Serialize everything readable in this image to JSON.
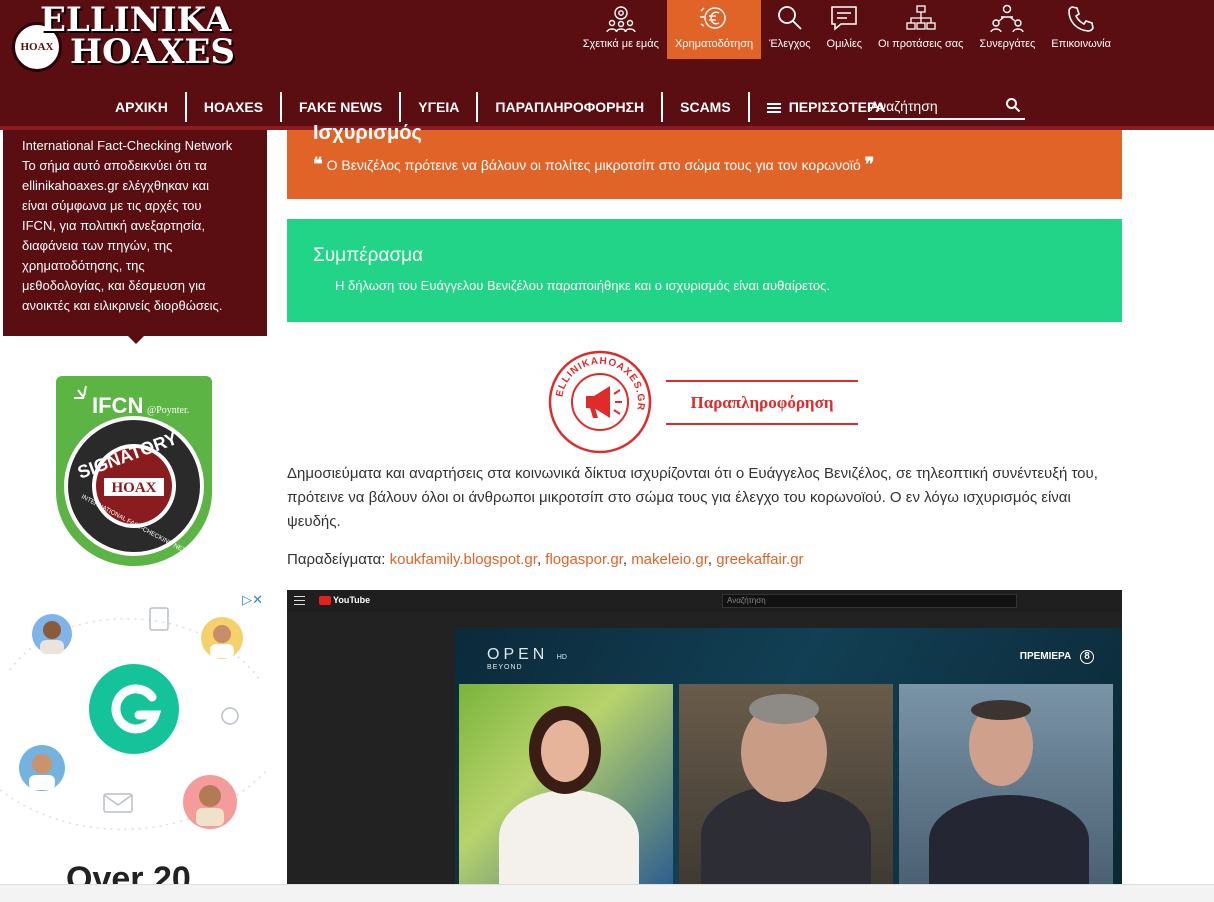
{
  "header": {
    "logo_line1": "ELLINIKA",
    "logo_line2": "HOAXES",
    "logo_seal": "HOAX",
    "top_nav": [
      {
        "label": "Σχετικά με εμάς",
        "icon": "team-gear-icon"
      },
      {
        "label": "Χρηματοδότηση",
        "icon": "funding-euro-icon",
        "active": true
      },
      {
        "label": "Έλεγχος",
        "icon": "magnifier-icon"
      },
      {
        "label": "Ομιλίες",
        "icon": "speech-bubble-icon"
      },
      {
        "label": "Οι προτάσεις σας",
        "icon": "network-icon"
      },
      {
        "label": "Συνεργάτες",
        "icon": "partners-icon"
      },
      {
        "label": "Επικοινωνία",
        "icon": "phone-icon"
      }
    ],
    "main_nav": [
      "ΑΡΧΙΚΗ",
      "HOAXES",
      "FAKE NEWS",
      "ΥΓΕΙΑ",
      "ΠΑΡΑΠΛΗΡΟΦΟΡΗΣΗ",
      "SCAMS",
      "ΠΕΡΙΣΣΟΤΕΡΑ"
    ],
    "search_placeholder": "Αναζήτηση"
  },
  "colors": {
    "header_bg": "#5a0e12",
    "accent_orange": "#e06428",
    "conclusion_green": "#22d487",
    "verdict_red": "#e02b2b"
  },
  "sidebar": {
    "ifcn_text_lines": [
      "International Fact-Checking Network",
      "Το σήμα αυτό αποδεικνύει ότι τα",
      "ellinikahoaxes.gr ελέγχθηκαν και",
      "είναι σύμφωνα με τις αρχές του",
      "IFCN, για πολιτική ανεξαρτησία,",
      "διαφάνεια των πηγών, της",
      "χρηματοδότησης, της",
      "μεθοδολογίας, και δέσμευση για",
      "ανοικτές και ειλικρινείς διορθώσεις."
    ],
    "badge": {
      "ifcn": "IFCN",
      "poynter": "@Poynter.",
      "signatory": "SIGNATORY",
      "hoax": "HOAX",
      "ring_text": "INTERNATIONAL FACT-CHECKING NETWORK"
    },
    "ad": {
      "headline": "Over 20"
    }
  },
  "article": {
    "claim_title": "Ισχυρισμός",
    "claim_text": "Ο Βενιζέλος πρότεινε να βάλουν οι πολίτες μικροτσίπ στο σώμα τους για τον κορωνοϊό",
    "conclusion_title": "Συμπέρασμα",
    "conclusion_text": "Η δήλωση του Ευάγγελου Βενιζέλου παραποιήθηκε και ο ισχυρισμός είναι αυθαίρετος.",
    "stamp_text": "ELLINIKAHOAXES.GR",
    "verdict": "Παραπληροφόρηση",
    "body": "Δημοσιεύματα και αναρτήσεις στα κοινωνικά δίκτυα ισχυρίζονται ότι ο Ευάγγελος Βενιζέλος, σε τηλεοπτική συνέντευξή του, πρότεινε να βάλουν όλοι οι άνθρωποι μικροτσίπ στο σώμα τους για έλεγχο του κορωνοϊού. Ο εν λόγω ισχυρισμός είναι ψευδής.",
    "examples_label": "Παραδείγματα:",
    "examples": [
      "koukfamily.blogspot.gr",
      "flogaspor.gr",
      "makeleio.gr",
      "greekaffair.gr"
    ]
  },
  "video": {
    "yt_label": "YouTube",
    "search_placeholder": "Αναζήτηση",
    "channel": "OPEN",
    "channel_sub": "BEYOND",
    "channel_hd": "HD",
    "premiere": "ΠΡΕΜΙΕΡΑ"
  }
}
